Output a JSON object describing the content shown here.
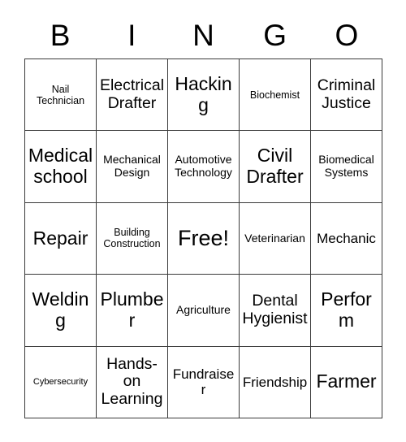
{
  "card": {
    "header_letters": [
      "B",
      "I",
      "N",
      "G",
      "O"
    ],
    "free_space_label": "Free!",
    "grid": [
      [
        {
          "label": "Nail Technician",
          "size": "s"
        },
        {
          "label": "Electrical Drafter",
          "size": "xl"
        },
        {
          "label": "Hacking",
          "size": "xxl"
        },
        {
          "label": "Biochemist",
          "size": "s"
        },
        {
          "label": "Criminal Justice",
          "size": "xl"
        }
      ],
      [
        {
          "label": "Medical school",
          "size": "xxl"
        },
        {
          "label": "Mechanical Design",
          "size": "m"
        },
        {
          "label": "Automotive Technology",
          "size": "m"
        },
        {
          "label": "Civil Drafter",
          "size": "xxl"
        },
        {
          "label": "Biomedical Systems",
          "size": "m"
        }
      ],
      [
        {
          "label": "Repair",
          "size": "xxl"
        },
        {
          "label": "Building Construction",
          "size": "s"
        },
        {
          "label": "Free!",
          "size": "free"
        },
        {
          "label": "Veterinarian",
          "size": "m"
        },
        {
          "label": "Mechanic",
          "size": "l"
        }
      ],
      [
        {
          "label": "Welding",
          "size": "xxl"
        },
        {
          "label": "Plumber",
          "size": "xxl"
        },
        {
          "label": "Agriculture",
          "size": "m"
        },
        {
          "label": "Dental Hygienist",
          "size": "xl"
        },
        {
          "label": "Perform",
          "size": "xxl"
        }
      ],
      [
        {
          "label": "Cybersecurity",
          "size": "xs"
        },
        {
          "label": "Hands-on Learning",
          "size": "xl"
        },
        {
          "label": "Fundraiser",
          "size": "l"
        },
        {
          "label": "Friendship",
          "size": "l"
        },
        {
          "label": "Farmer",
          "size": "xxl"
        }
      ]
    ]
  },
  "colors": {
    "background": "#ffffff",
    "border": "#3a3a3a",
    "text": "#000000"
  }
}
